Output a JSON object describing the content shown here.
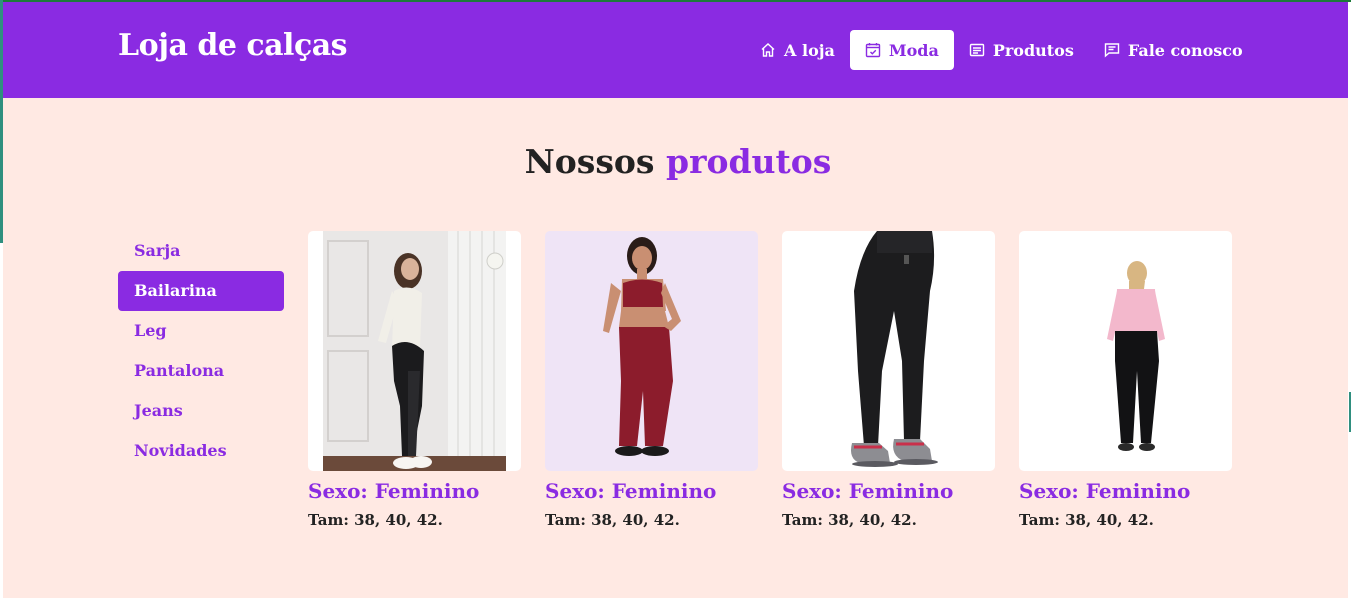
{
  "header": {
    "brand": "Loja de calças",
    "nav": [
      {
        "label": "A loja",
        "icon": "home-icon",
        "active": false
      },
      {
        "label": "Moda",
        "icon": "calendar-check-icon",
        "active": true
      },
      {
        "label": "Produtos",
        "icon": "list-icon",
        "active": false
      },
      {
        "label": "Fale conosco",
        "icon": "chat-icon",
        "active": false
      }
    ]
  },
  "main": {
    "heading_prefix": "Nossos",
    "heading_accent": "produtos"
  },
  "sidebar": {
    "items": [
      {
        "label": "Sarja",
        "active": false
      },
      {
        "label": "Bailarina",
        "active": true
      },
      {
        "label": "Leg",
        "active": false
      },
      {
        "label": "Pantalona",
        "active": false
      },
      {
        "label": "Jeans",
        "active": false
      },
      {
        "label": "Novidades",
        "active": false
      }
    ]
  },
  "products": [
    {
      "title": "Sexo: Feminino",
      "sizes": "Tam: 38, 40, 42.",
      "image": "woman-black-flare-pants-photo"
    },
    {
      "title": "Sexo: Feminino",
      "sizes": "Tam: 38, 40, 42.",
      "image": "woman-burgundy-set-photo"
    },
    {
      "title": "Sexo: Feminino",
      "sizes": "Tam: 38, 40, 42.",
      "image": "black-leggings-sneakers-photo"
    },
    {
      "title": "Sexo: Feminino",
      "sizes": "Tam: 38, 40, 42.",
      "image": "woman-pink-top-black-pants-photo"
    }
  ],
  "colors": {
    "primary": "#8a2be2",
    "background": "#ffe9e3",
    "text": "#222222"
  }
}
